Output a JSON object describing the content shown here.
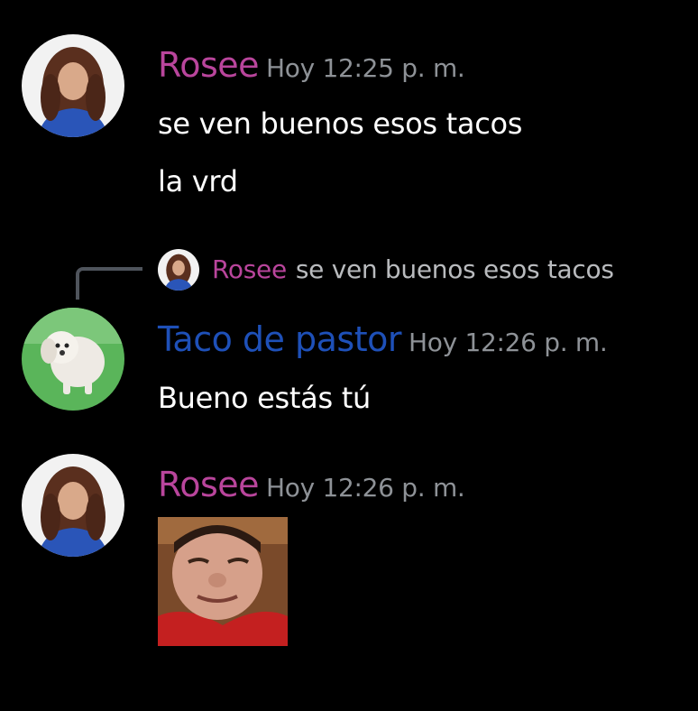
{
  "colors": {
    "background": "#000000",
    "rosee_name": "#b9459c",
    "taco_name": "#1e50b8",
    "timestamp": "#8e9297",
    "message_text": "#ffffff",
    "reply_text": "#b9bbbe"
  },
  "messages": [
    {
      "author": "Rosee",
      "timestamp": "Hoy 12:25 p. m.",
      "avatar_icon": "curly-hair-girl-avatar",
      "lines": [
        "se ven buenos esos tacos",
        "la vrd"
      ]
    },
    {
      "author": "Taco de pastor",
      "timestamp": "Hoy 12:26 p. m.",
      "avatar_icon": "white-dog-avatar",
      "reply": {
        "author": "Rosee",
        "content": "se ven buenos esos tacos"
      },
      "lines": [
        "Bueno estás tú"
      ]
    },
    {
      "author": "Rosee",
      "timestamp": "Hoy 12:26 p. m.",
      "avatar_icon": "curly-hair-girl-avatar",
      "attachment": "selfie-photo"
    }
  ]
}
